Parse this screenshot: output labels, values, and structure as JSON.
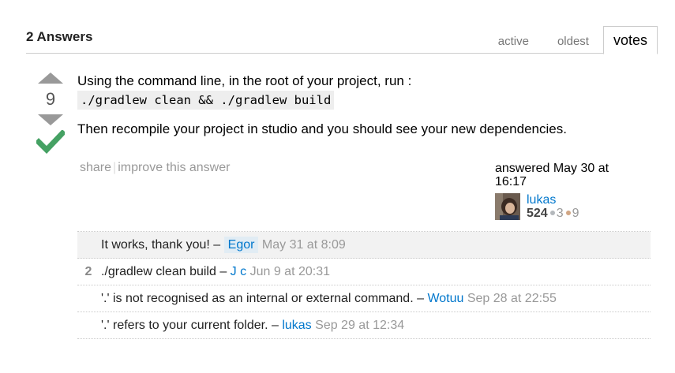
{
  "header": {
    "answers_count": "2 Answers",
    "tabs": [
      {
        "label": "active"
      },
      {
        "label": "oldest"
      },
      {
        "label": "votes"
      }
    ]
  },
  "answer": {
    "vote_count": "9",
    "line1": "Using the command line, in the root of your project, run :",
    "code": "./gradlew clean && ./gradlew build",
    "line2": "Then recompile your project in studio and you should see your new dependencies.",
    "menu": {
      "share": "share",
      "separator": "|",
      "improve": "improve this answer"
    },
    "user_info": {
      "action_time": "answered May 30 at 16:17",
      "user_name": "lukas",
      "reputation": "524",
      "silver_badges": "3",
      "bronze_badges": "9"
    }
  },
  "comments": [
    {
      "score": "",
      "text": "It works, thank you! –",
      "user": "Egor",
      "date": "May 31 at 8:09"
    },
    {
      "score": "2",
      "text": "./gradlew clean build –",
      "user": "J c",
      "date": "Jun 9 at 20:31"
    },
    {
      "score": "",
      "text": "'.' is not recognised as an internal or external command. –",
      "user": "Wotuu",
      "date": "Sep 28 at 22:55"
    },
    {
      "score": "",
      "text": "'.' refers to your current folder. –",
      "user": "lukas",
      "date": "Sep 29 at 12:34"
    }
  ],
  "colors": {
    "accepted": "#45a163",
    "link": "#0077cc",
    "silver_badge": "#b4b8bc",
    "bronze_badge": "#d1a684"
  }
}
